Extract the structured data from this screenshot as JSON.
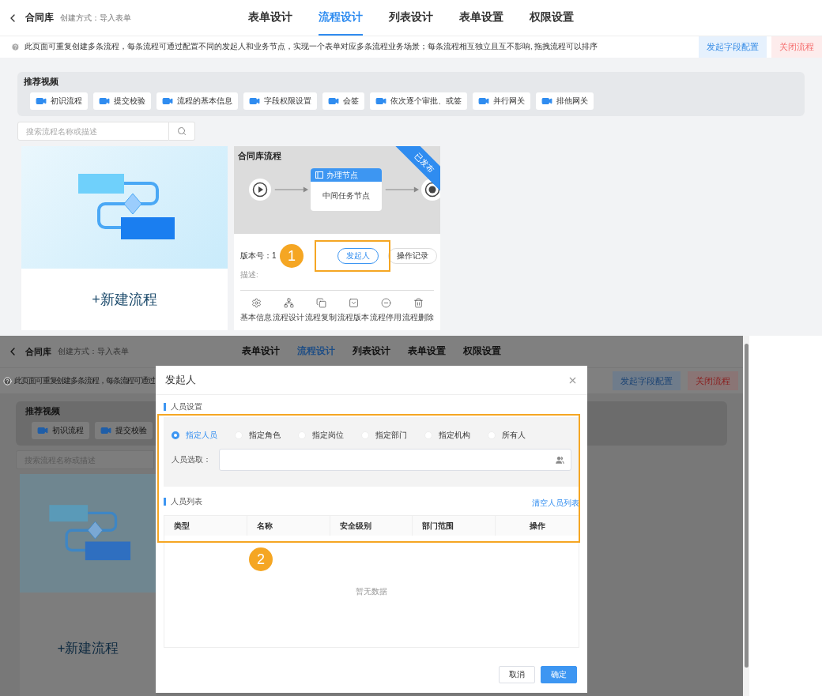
{
  "top": {
    "header": {
      "title": "合同库",
      "subtitle": "创建方式：导入表单"
    },
    "tabs": [
      {
        "label": "表单设计",
        "selected": false
      },
      {
        "label": "流程设计",
        "selected": true
      },
      {
        "label": "列表设计",
        "selected": false
      },
      {
        "label": "表单设置",
        "selected": false
      },
      {
        "label": "权限设置",
        "selected": false
      }
    ],
    "tip": "此页面可重复创建多条流程，每条流程可通过配置不同的发起人和业务节点，实现一个表单对应多条流程业务场景；每条流程相互独立且互不影响, 拖拽流程可以排序",
    "actions": [
      {
        "label": "发起字段配置",
        "kind": "primary"
      },
      {
        "label": "关闭流程",
        "kind": "danger"
      }
    ],
    "videos": {
      "title": "推荐视频",
      "items": [
        "初识流程",
        "提交校验",
        "流程的基本信息",
        "字段权限设置",
        "会签",
        "依次逐个审批、或签",
        "并行网关",
        "排他网关"
      ]
    },
    "search": {
      "placeholder": "搜索流程名称或描述"
    },
    "new_flow": "+新建流程",
    "flow_card": {
      "title": "合同库流程",
      "status": "已发布",
      "node_title": "办理节点",
      "node_text": "中间任务节点",
      "version": "版本号：1",
      "initiator_button": "发起人",
      "log_button": "操作记录",
      "description": "描述:",
      "actions": [
        {
          "label": "基本信息",
          "kind": "info"
        },
        {
          "label": "流程设计",
          "kind": "design"
        },
        {
          "label": "流程复制",
          "kind": "copy"
        },
        {
          "label": "流程版本",
          "kind": "version"
        },
        {
          "label": "流程停用",
          "kind": "disable"
        },
        {
          "label": "流程删除",
          "kind": "delete"
        }
      ]
    },
    "callout": "1"
  },
  "bottom": {
    "header": {
      "title": "合同库",
      "subtitle": "创建方式：导入表单"
    },
    "tabs": [
      {
        "label": "表单设计",
        "selected": false
      },
      {
        "label": "流程设计",
        "selected": true
      },
      {
        "label": "列表设计",
        "selected": false
      },
      {
        "label": "表单设置",
        "selected": false
      },
      {
        "label": "权限设置",
        "selected": false
      }
    ],
    "tip": "此页面可重复创建多条流程，每条流程可通过",
    "actions": [
      {
        "label": "发起字段配置",
        "kind": "primary"
      },
      {
        "label": "关闭流程",
        "kind": "danger"
      }
    ],
    "videos": {
      "title": "推荐视频",
      "items": [
        "初识流程",
        "提交校验"
      ]
    },
    "search": {
      "placeholder": "搜索流程名称或描述"
    },
    "new_flow": "+新建流程",
    "dialog": {
      "title": "发起人",
      "section_settings": "人员设置",
      "options": [
        {
          "label": "指定人员",
          "selected": true
        },
        {
          "label": "指定角色",
          "selected": false
        },
        {
          "label": "指定岗位",
          "selected": false
        },
        {
          "label": "指定部门",
          "selected": false
        },
        {
          "label": "指定机构",
          "selected": false
        },
        {
          "label": "所有人",
          "selected": false
        }
      ],
      "picker_label": "人员选取：",
      "section_list": "人员列表",
      "clear_link": "清空人员列表",
      "columns": [
        "类型",
        "名称",
        "安全级别",
        "部门范围",
        "操作"
      ],
      "empty": "暂无数据",
      "buttons": [
        {
          "label": "取消",
          "kind": "default"
        },
        {
          "label": "确定",
          "kind": "primary"
        }
      ]
    },
    "callout": "2"
  }
}
